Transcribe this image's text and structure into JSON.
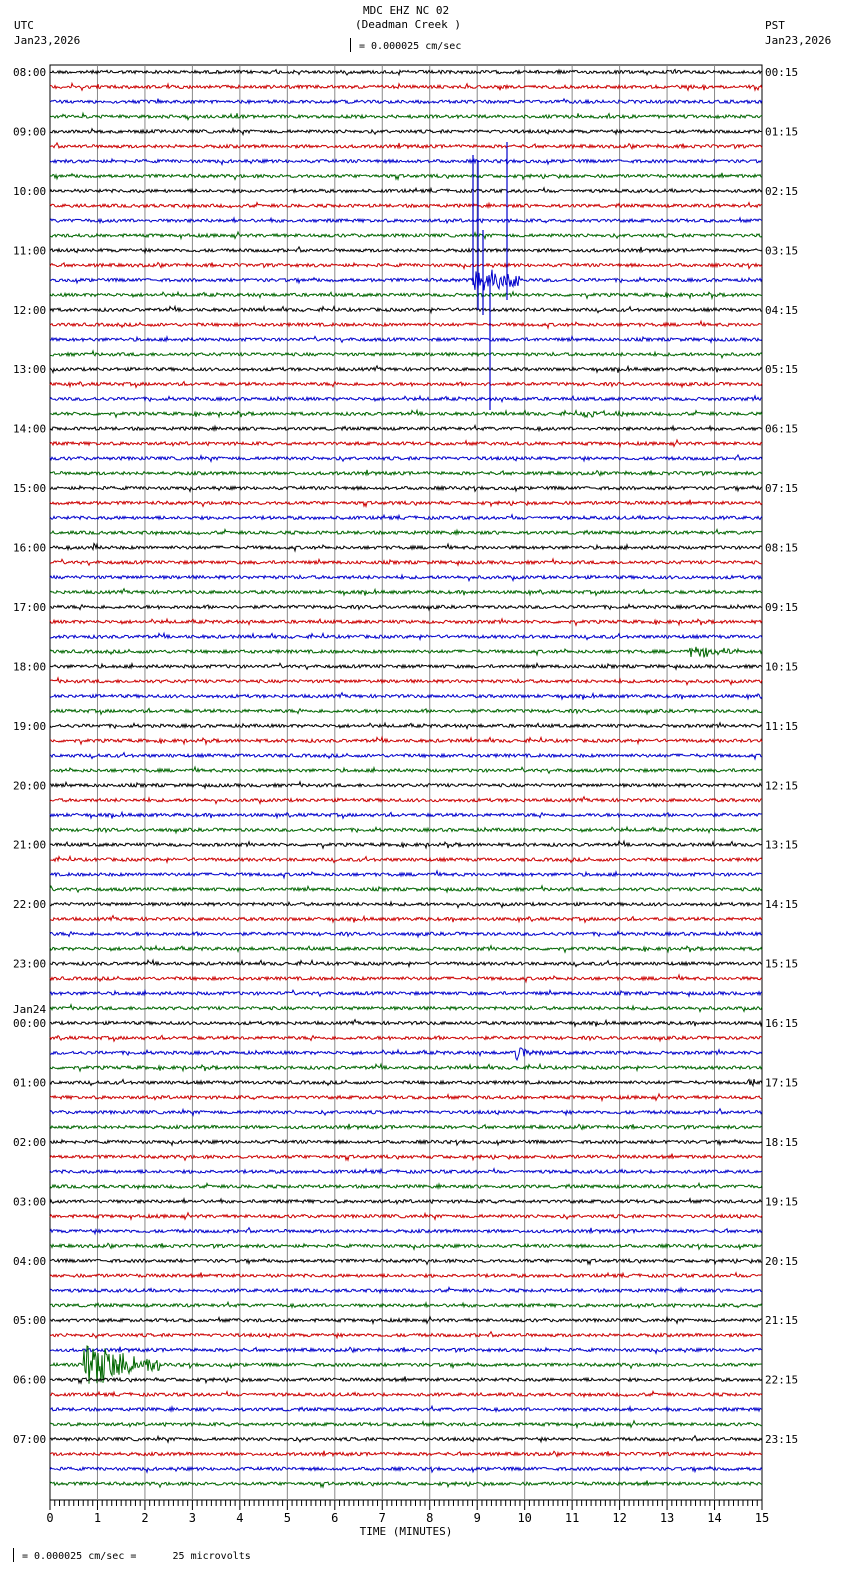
{
  "header": {
    "title": "MDC EHZ NC 02",
    "subtitle": "(Deadman Creek )",
    "left_tz": "UTC",
    "left_date": "Jan23,2026",
    "right_tz": "PST",
    "right_date": "Jan23,2026",
    "scale_text": "= 0.000025 cm/sec"
  },
  "footer": {
    "scale_text": "= 0.000025 cm/sec =      25 microvolts"
  },
  "chart_data": {
    "type": "line",
    "title": "MDC EHZ NC 02 (Deadman Creek )",
    "xlabel": "TIME (MINUTES)",
    "xlim": [
      0,
      15
    ],
    "x_ticks": [
      "0",
      "1",
      "2",
      "3",
      "4",
      "5",
      "6",
      "7",
      "8",
      "9",
      "10",
      "11",
      "12",
      "13",
      "14",
      "15"
    ],
    "traces_per_hour": 4,
    "trace_colors": [
      "#000000",
      "#cc0000",
      "#0000cc",
      "#006600"
    ],
    "left_labels": [
      "08:00",
      "09:00",
      "10:00",
      "11:00",
      "12:00",
      "13:00",
      "14:00",
      "15:00",
      "16:00",
      "17:00",
      "18:00",
      "19:00",
      "20:00",
      "21:00",
      "22:00",
      "23:00",
      "00:00",
      "01:00",
      "02:00",
      "03:00",
      "04:00",
      "05:00",
      "06:00",
      "07:00"
    ],
    "date_change": {
      "hour_index": 16,
      "label": "Jan24"
    },
    "right_labels": [
      "00:15",
      "01:15",
      "02:15",
      "03:15",
      "04:15",
      "05:15",
      "06:15",
      "07:15",
      "08:15",
      "09:15",
      "10:15",
      "11:15",
      "12:15",
      "13:15",
      "14:15",
      "15:15",
      "16:15",
      "17:15",
      "18:15",
      "19:15",
      "20:15",
      "21:15",
      "22:15",
      "23:15"
    ],
    "events": [
      {
        "trace": 14,
        "minute": 8.9,
        "duration": 1.0,
        "amplitude": 9,
        "kind": "spike"
      },
      {
        "trace": 23,
        "minute": 11.2,
        "duration": 0.9,
        "amplitude": 3,
        "kind": "burst"
      },
      {
        "trace": 32,
        "minute": 0.9,
        "duration": 0.1,
        "amplitude": 6,
        "kind": "burst"
      },
      {
        "trace": 39,
        "minute": 13.5,
        "duration": 1.0,
        "amplitude": 7,
        "kind": "burst"
      },
      {
        "trace": 66,
        "minute": 9.8,
        "duration": 0.6,
        "amplitude": 8,
        "kind": "burst"
      },
      {
        "trace": 68,
        "minute": 14.7,
        "duration": 0.15,
        "amplitude": 10,
        "kind": "burst"
      },
      {
        "trace": 87,
        "minute": 0.7,
        "duration": 1.6,
        "amplitude": 25,
        "kind": "burst"
      }
    ]
  }
}
